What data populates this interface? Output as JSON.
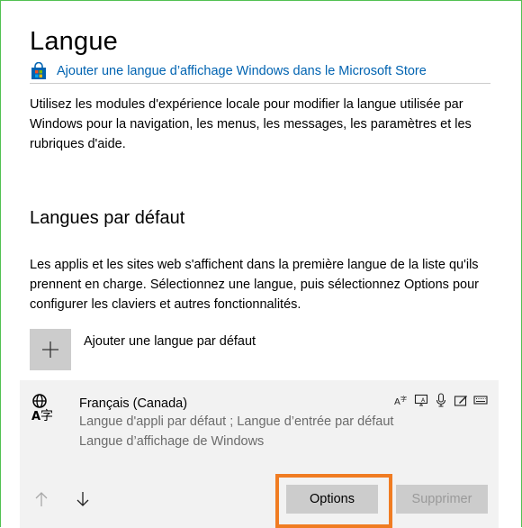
{
  "page": {
    "title": "Langue",
    "store_link": "Ajouter une langue d’affichage Windows dans le Microsoft Store",
    "intro": "Utilisez les modules d'expérience locale pour modifier la langue utilisée par Windows pour la navigation, les menus, les messages, les paramètres et les rubriques d'aide."
  },
  "defaults_section": {
    "title": "Langues par défaut",
    "description": "Les applis et les sites web s'affichent dans la première langue de la liste qu'ils prennent en charge. Sélectionnez une langue, puis sélectionnez Options pour configurer les claviers et autres fonctionnalités.",
    "add_label": "Ajouter une langue par défaut"
  },
  "language_card": {
    "name": "Français (Canada)",
    "sub_line_1": "Langue d'appli par défaut ; Langue d’entrée par défaut",
    "sub_line_2": "Langue d’affichage de Windows",
    "options_label": "Options",
    "remove_label": "Supprimer",
    "feature_icons": [
      "text-to-speech-icon",
      "display-language-icon",
      "microphone-icon",
      "handwriting-icon",
      "keyboard-icon"
    ]
  },
  "colors": {
    "accent_link": "#0063b1",
    "highlight": "#f07c22",
    "frame_border": "#52c152",
    "card_bg": "#f2f2f2",
    "button_bg": "#cccccc"
  }
}
